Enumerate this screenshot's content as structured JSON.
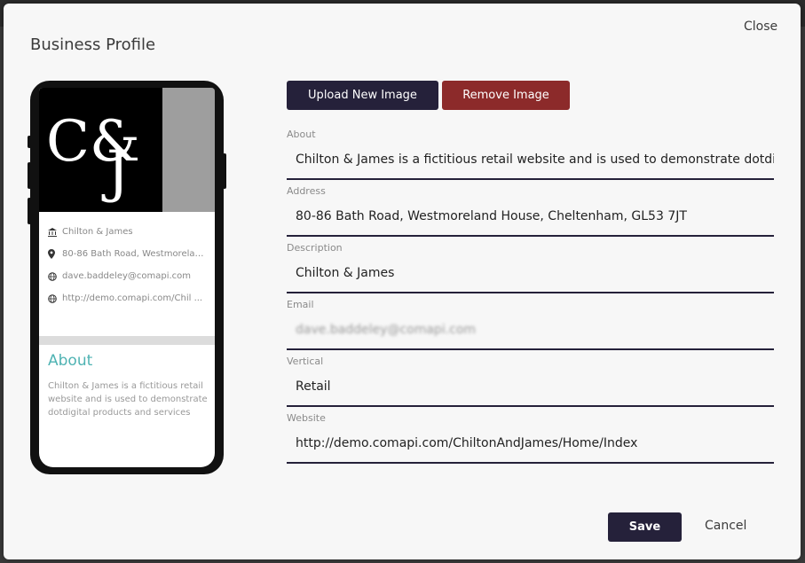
{
  "modal": {
    "title": "Business Profile",
    "close_label": "Close"
  },
  "preview": {
    "logo_text_top": "C&",
    "logo_text_bottom": "J",
    "info": [
      {
        "icon": "bank-icon",
        "text": "Chilton & James"
      },
      {
        "icon": "location-pin-icon",
        "text": "80-86 Bath Road, Westmorela ..."
      },
      {
        "icon": "globe-icon",
        "text": "dave.baddeley@comapi.com"
      },
      {
        "icon": "globe-icon",
        "text": "http://demo.comapi.com/Chil ..."
      }
    ],
    "about_heading": "About",
    "about_text": "Chilton & James is a fictitious retail website and is used to demonstrate dotdigital products and services"
  },
  "actions": {
    "upload_label": "Upload New Image",
    "remove_label": "Remove Image",
    "save_label": "Save",
    "cancel_label": "Cancel"
  },
  "fields": [
    {
      "label": "About",
      "value": "Chilton & James is a fictitious retail website and is used to demonstrate dotdigital products and services"
    },
    {
      "label": "Address",
      "value": "80-86 Bath Road, Westmoreland House, Cheltenham, GL53 7JT"
    },
    {
      "label": "Description",
      "value": "Chilton & James"
    },
    {
      "label": "Email",
      "value": "dave.baddeley@comapi.com"
    },
    {
      "label": "Vertical",
      "value": "Retail"
    },
    {
      "label": "Website",
      "value": "http://demo.comapi.com/ChiltonAndJames/Home/Index"
    }
  ],
  "colors": {
    "primary": "#25213a",
    "danger": "#8c2a2a",
    "accent": "#4fb3b3"
  }
}
